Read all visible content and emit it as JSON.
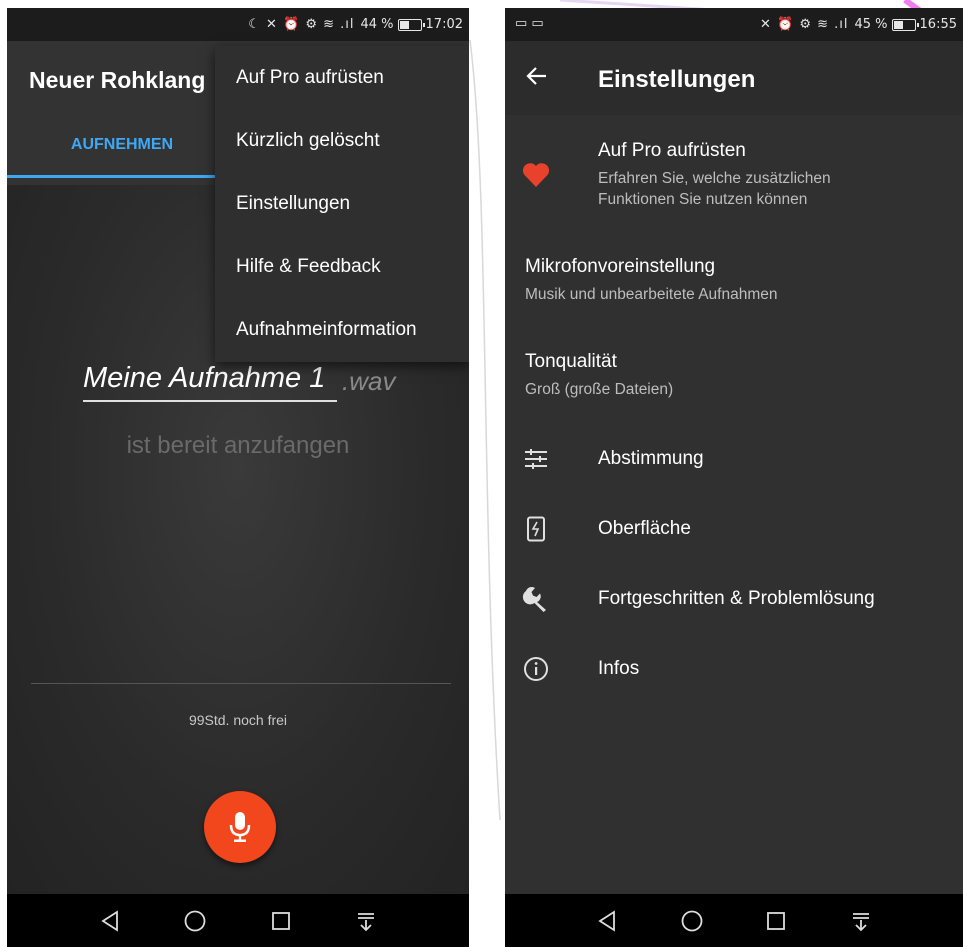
{
  "left_screen": {
    "statusbar": {
      "icons": "☾ ✕ ⏰ ⚙ ≋ .ıl",
      "battery": "44 %",
      "time": "17:02"
    },
    "app_title": "Neuer Rohklang",
    "tab_record": "AUFNEHMEN",
    "menu": [
      "Auf Pro aufrüsten",
      "Kürzlich gelöscht",
      "Einstellungen",
      "Hilfe & Feedback",
      "Aufnahmeinformation"
    ],
    "recording_name": "Meine Aufnahme 1",
    "recording_ext": ".wav",
    "status": "ist bereit anzufangen",
    "free_space": "99Std. noch frei"
  },
  "right_screen": {
    "statusbar": {
      "left_icons": "▭ ▭",
      "icons": "✕ ⏰ ⚙ ≋ .ıl",
      "battery": "45 %",
      "time": "16:55"
    },
    "title": "Einstellungen",
    "upgrade": {
      "title": "Auf Pro aufrüsten",
      "subtitle": "Erfahren Sie, welche zusätzlichen Funktionen Sie nutzen können"
    },
    "mic_preset": {
      "title": "Mikrofonvoreinstellung",
      "subtitle": "Musik und unbearbeitete Aufnahmen"
    },
    "quality": {
      "title": "Tonqualität",
      "subtitle": "Groß (große Dateien)"
    },
    "tuning": "Abstimmung",
    "interface": "Oberfläche",
    "advanced": "Fortgeschritten & Problemlösung",
    "about": "Infos"
  },
  "colors": {
    "accent_blue": "#3fa8f5",
    "fab_red": "#f2461c",
    "heart_red": "#e8412c"
  }
}
